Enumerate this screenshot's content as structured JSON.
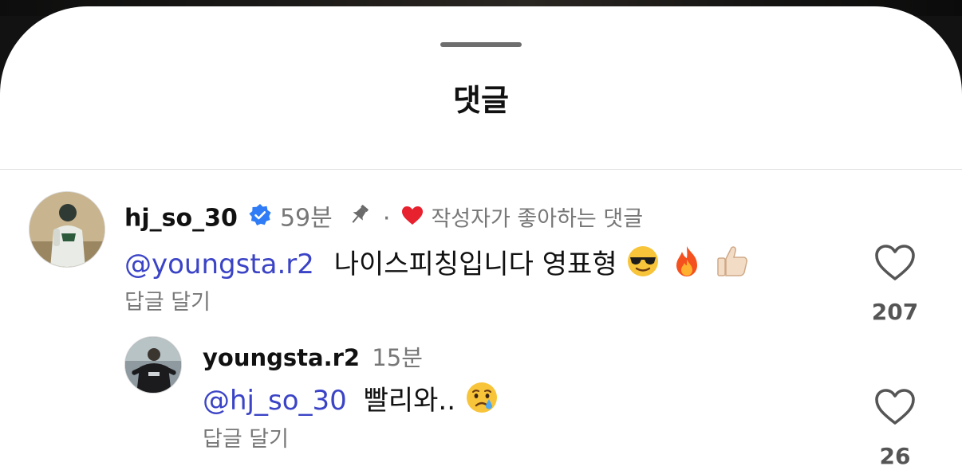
{
  "sheet": {
    "title": "댓글"
  },
  "comments": [
    {
      "username": "hj_so_30",
      "verified": true,
      "time": "59분",
      "pinned": true,
      "separator": "·",
      "creator_liked_label": "작성자가 좋아하는 댓글",
      "mention": "@youngsta.r2",
      "text": "나이스피칭입니다 영표형",
      "emojis": [
        "smiling-face-with-sunglasses",
        "fire",
        "thumbs-up-light-skin"
      ],
      "reply_label": "답글 달기",
      "likes": "207"
    },
    {
      "username": "youngsta.r2",
      "time": "15분",
      "mention": "@hj_so_30",
      "text": "빨리와..",
      "emojis": [
        "crying-face"
      ],
      "reply_label": "답글 달기",
      "likes": "26"
    }
  ],
  "colors": {
    "mention": "#3b44c6",
    "verified": "#2f7cf6",
    "heart_red": "#e8212e",
    "meta": "#777777"
  }
}
